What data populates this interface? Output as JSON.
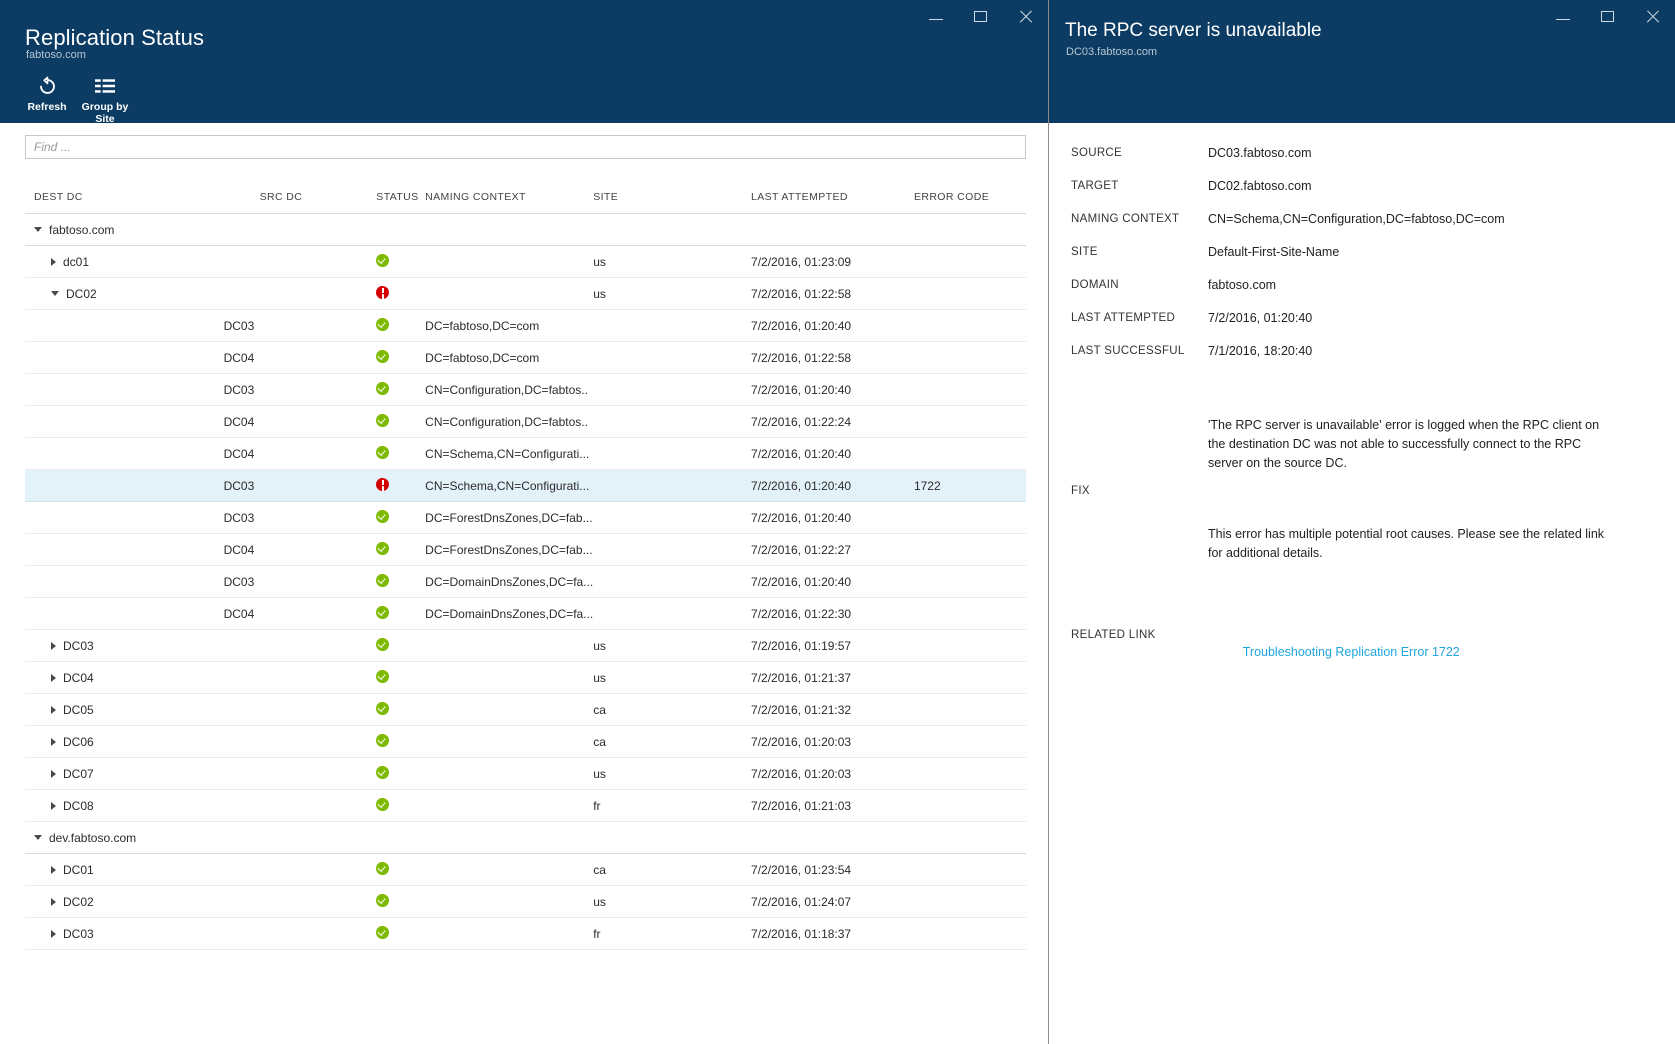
{
  "left_window": {
    "title": "Replication Status",
    "subtitle": "fabtoso.com",
    "window_controls": {
      "minimize": "minimize",
      "maximize": "maximize",
      "close": "close"
    },
    "toolbar": [
      {
        "icon": "refresh-icon",
        "label": "Refresh"
      },
      {
        "icon": "group-by-icon",
        "label": "Group by\nSite"
      }
    ],
    "search": {
      "value": "",
      "placeholder": "Find ..."
    },
    "table": {
      "columns": [
        "DEST DC",
        "SRC DC",
        "STATUS",
        "NAMING CONTEXT",
        "SITE",
        "LAST ATTEMPTED",
        "ERROR CODE"
      ],
      "rows": [
        {
          "kind": "group",
          "indent": 0,
          "twisty": "down",
          "dest": "fabtoso.com",
          "src": "",
          "status": "",
          "nc": "",
          "site": "",
          "last": "",
          "err": ""
        },
        {
          "kind": "dc",
          "indent": 1,
          "twisty": "right",
          "dest": "dc01",
          "src": "",
          "status": "ok",
          "nc": "",
          "site": "us",
          "last": "7/2/2016, 01:23:09",
          "err": ""
        },
        {
          "kind": "dc",
          "indent": 1,
          "twisty": "down",
          "dest": "DC02",
          "src": "",
          "status": "err",
          "nc": "",
          "site": "us",
          "last": "7/2/2016, 01:22:58",
          "err": ""
        },
        {
          "kind": "child",
          "indent": 2,
          "twisty": "",
          "dest": "",
          "src": "DC03",
          "status": "ok",
          "nc": "DC=fabtoso,DC=com",
          "site": "",
          "last": "7/2/2016, 01:20:40",
          "err": ""
        },
        {
          "kind": "child",
          "indent": 2,
          "twisty": "",
          "dest": "",
          "src": "DC04",
          "status": "ok",
          "nc": "DC=fabtoso,DC=com",
          "site": "",
          "last": "7/2/2016, 01:22:58",
          "err": ""
        },
        {
          "kind": "child",
          "indent": 2,
          "twisty": "",
          "dest": "",
          "src": "DC03",
          "status": "ok",
          "nc": "CN=Configuration,DC=fabtos..",
          "site": "",
          "last": "7/2/2016, 01:20:40",
          "err": ""
        },
        {
          "kind": "child",
          "indent": 2,
          "twisty": "",
          "dest": "",
          "src": "DC04",
          "status": "ok",
          "nc": "CN=Configuration,DC=fabtos..",
          "site": "",
          "last": "7/2/2016, 01:22:24",
          "err": ""
        },
        {
          "kind": "child",
          "indent": 2,
          "twisty": "",
          "dest": "",
          "src": "DC04",
          "status": "ok",
          "nc": "CN=Schema,CN=Configurati...",
          "site": "",
          "last": "7/2/2016, 01:20:40",
          "err": ""
        },
        {
          "kind": "child",
          "indent": 2,
          "twisty": "",
          "selected": true,
          "dest": "",
          "src": "DC03",
          "status": "err",
          "nc": "CN=Schema,CN=Configurati...",
          "site": "",
          "last": "7/2/2016, 01:20:40",
          "err": "1722"
        },
        {
          "kind": "child",
          "indent": 2,
          "twisty": "",
          "dest": "",
          "src": "DC03",
          "status": "ok",
          "nc": "DC=ForestDnsZones,DC=fab...",
          "site": "",
          "last": "7/2/2016, 01:20:40",
          "err": ""
        },
        {
          "kind": "child",
          "indent": 2,
          "twisty": "",
          "dest": "",
          "src": "DC04",
          "status": "ok",
          "nc": "DC=ForestDnsZones,DC=fab...",
          "site": "",
          "last": "7/2/2016, 01:22:27",
          "err": ""
        },
        {
          "kind": "child",
          "indent": 2,
          "twisty": "",
          "dest": "",
          "src": "DC03",
          "status": "ok",
          "nc": "DC=DomainDnsZones,DC=fa...",
          "site": "",
          "last": "7/2/2016, 01:20:40",
          "err": ""
        },
        {
          "kind": "child",
          "indent": 2,
          "twisty": "",
          "dest": "",
          "src": "DC04",
          "status": "ok",
          "nc": "DC=DomainDnsZones,DC=fa...",
          "site": "",
          "last": "7/2/2016, 01:22:30",
          "err": ""
        },
        {
          "kind": "dc",
          "indent": 1,
          "twisty": "right",
          "dest": "DC03",
          "src": "",
          "status": "ok",
          "nc": "",
          "site": "us",
          "last": "7/2/2016, 01:19:57",
          "err": ""
        },
        {
          "kind": "dc",
          "indent": 1,
          "twisty": "right",
          "dest": "DC04",
          "src": "",
          "status": "ok",
          "nc": "",
          "site": "us",
          "last": "7/2/2016, 01:21:37",
          "err": ""
        },
        {
          "kind": "dc",
          "indent": 1,
          "twisty": "right",
          "dest": "DC05",
          "src": "",
          "status": "ok",
          "nc": "",
          "site": "ca",
          "last": "7/2/2016, 01:21:32",
          "err": ""
        },
        {
          "kind": "dc",
          "indent": 1,
          "twisty": "right",
          "dest": "DC06",
          "src": "",
          "status": "ok",
          "nc": "",
          "site": "ca",
          "last": "7/2/2016, 01:20:03",
          "err": ""
        },
        {
          "kind": "dc",
          "indent": 1,
          "twisty": "right",
          "dest": "DC07",
          "src": "",
          "status": "ok",
          "nc": "",
          "site": "us",
          "last": "7/2/2016, 01:20:03",
          "err": ""
        },
        {
          "kind": "dc",
          "indent": 1,
          "twisty": "right",
          "dest": "DC08",
          "src": "",
          "status": "ok",
          "nc": "",
          "site": "fr",
          "last": "7/2/2016, 01:21:03",
          "err": ""
        },
        {
          "kind": "group",
          "indent": 0,
          "twisty": "down",
          "dest": "dev.fabtoso.com",
          "src": "",
          "status": "",
          "nc": "",
          "site": "",
          "last": "",
          "err": ""
        },
        {
          "kind": "dc",
          "indent": 1,
          "twisty": "right",
          "dest": "DC01",
          "src": "",
          "status": "ok",
          "nc": "",
          "site": "ca",
          "last": "7/2/2016, 01:23:54",
          "err": ""
        },
        {
          "kind": "dc",
          "indent": 1,
          "twisty": "right",
          "dest": "DC02",
          "src": "",
          "status": "ok",
          "nc": "",
          "site": "us",
          "last": "7/2/2016, 01:24:07",
          "err": ""
        },
        {
          "kind": "dc",
          "indent": 1,
          "twisty": "right",
          "dest": "DC03",
          "src": "",
          "status": "ok",
          "nc": "",
          "site": "fr",
          "last": "7/2/2016, 01:18:37",
          "err": ""
        }
      ]
    }
  },
  "right_window": {
    "title": "The RPC server is unavailable",
    "subtitle": "DC03.fabtoso.com",
    "window_controls": {
      "minimize": "minimize",
      "maximize": "maximize",
      "close": "close"
    },
    "details": [
      {
        "label": "SOURCE",
        "value": "DC03.fabtoso.com"
      },
      {
        "label": "TARGET",
        "value": "DC02.fabtoso.com"
      },
      {
        "label": "NAMING CONTEXT",
        "value": "CN=Schema,CN=Configuration,DC=fabtoso,DC=com"
      },
      {
        "label": "SITE",
        "value": "Default-First-Site-Name"
      },
      {
        "label": "DOMAIN",
        "value": "fabtoso.com"
      },
      {
        "label": "LAST ATTEMPTED",
        "value": "7/2/2016, 01:20:40"
      },
      {
        "label": "LAST SUCCESSFUL",
        "value": "7/1/2016, 18:20:40"
      }
    ],
    "fix": {
      "label": "FIX",
      "paragraphs": [
        "'The RPC server is unavailable' error is logged when the RPC client on the destination DC was not able to successfully connect to the RPC server on the source DC.",
        "This error has multiple potential root causes. Please see the related link for additional details."
      ]
    },
    "related_link": {
      "label": "RELATED LINK",
      "text": "Troubleshooting Replication Error 1722"
    }
  },
  "colors": {
    "header_blue": "#0c3c63",
    "status_ok": "#7fba00",
    "status_error": "#d40000",
    "link": "#1fa5dd",
    "selected_row": "#e3f1f9"
  }
}
